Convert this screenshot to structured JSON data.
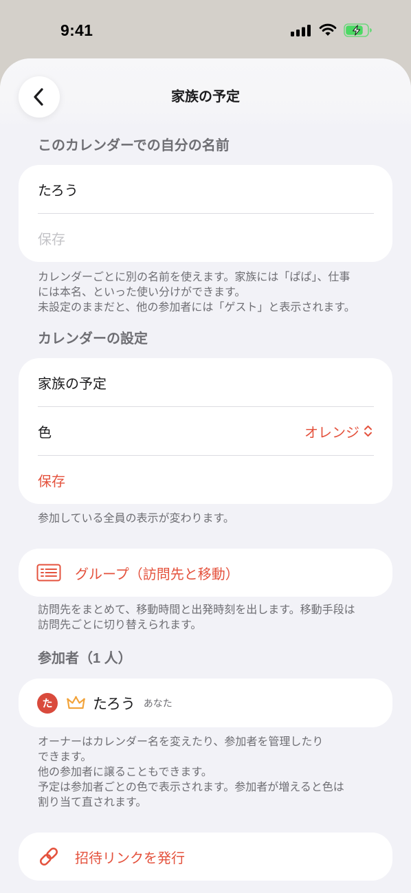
{
  "status_bar": {
    "time": "9:41",
    "signal_icon": "cellular-signal-icon",
    "wifi_icon": "wifi-icon",
    "battery_icon": "battery-charging-icon",
    "battery_level": 0.8,
    "charging": true
  },
  "header": {
    "title": "家族の予定",
    "back_icon": "chevron-left-icon"
  },
  "name_section": {
    "header": "このカレンダーでの自分の名前",
    "name_value": "たろう",
    "save_label": "保存",
    "save_enabled": false,
    "footer_lines": [
      "カレンダーごとに別の名前を使えます。家族には「ぱぱ」、仕事",
      "には本名、といった使い分けができます。",
      "未設定のままだと、他の参加者には「ゲスト」と表示されます。"
    ]
  },
  "calendar_section": {
    "header": "カレンダーの設定",
    "name_value": "家族の予定",
    "color_label": "色",
    "color_value": "オレンジ",
    "color_picker_icon": "chevron-up-down-icon",
    "save_label": "保存",
    "save_enabled": true,
    "footer_lines": [
      "参加している全員の表示が変わります。"
    ]
  },
  "group_section": {
    "icon": "list-icon",
    "label": "グループ（訪問先と移動）",
    "footer_lines": [
      "訪問先をまとめて、移動時間と出発時刻を出します。移動手段は",
      "訪問先ごとに切り替えられます。"
    ]
  },
  "participants_section": {
    "header": "参加者（1 人）",
    "participants": [
      {
        "avatar_initial": "た",
        "role_icon": "crown-icon",
        "name": "たろう",
        "badge": "あなた"
      }
    ],
    "footer_lines": [
      "オーナーはカレンダー名を変えたり、参加者を管理したり",
      "できます。",
      "他の参加者に譲ることもできます。",
      "予定は参加者ごとの色で表示されます。参加者が増えると色は",
      "割り当て直されます。"
    ]
  },
  "invite_section": {
    "icon": "link-icon",
    "label": "招待リンクを発行"
  },
  "colors": {
    "accent": "#e4523d",
    "secondary_text": "#6e6e73",
    "disabled_text": "#c3c3c7",
    "background": "#f2f2f7",
    "status_bar_bg": "#d4d0ca",
    "avatar": "#d94a3c",
    "crown": "#f2a33a",
    "battery": "#4cd964"
  }
}
